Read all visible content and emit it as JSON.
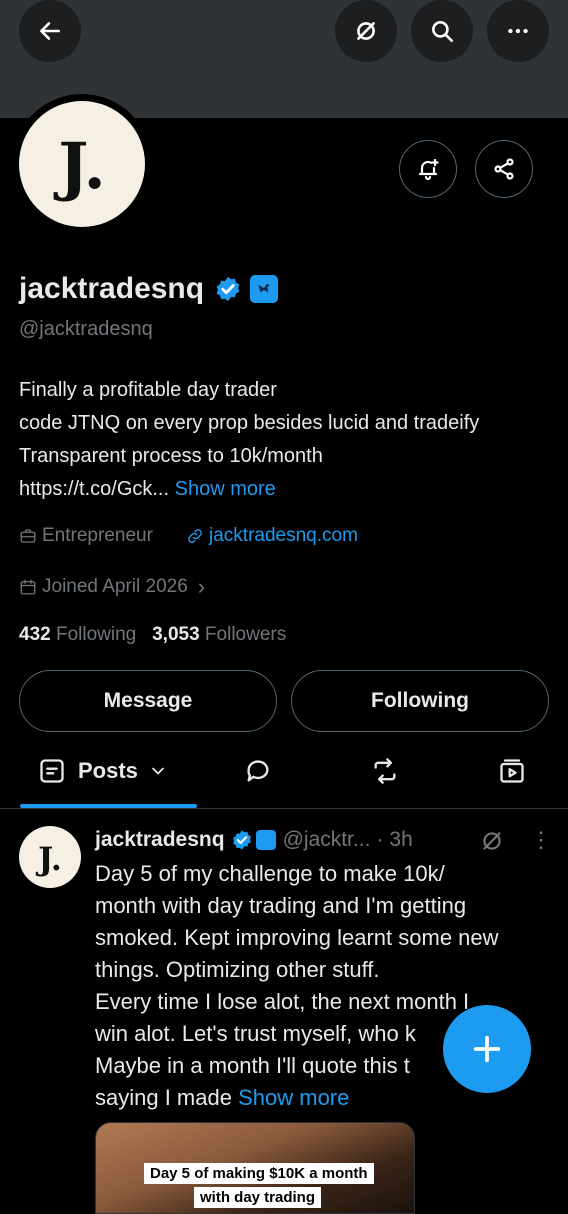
{
  "profile": {
    "display_name": "jacktradesnq",
    "handle": "@jacktradesnq",
    "avatar_letter": "J.",
    "bio_lines": [
      "Finally a profitable day trader",
      "code JTNQ on every prop besides lucid and tradeify",
      "Transparent process to 10k/month"
    ],
    "bio_link_text": "https://t.co/Gck...",
    "bio_show_more": "Show more",
    "category": "Entrepreneur",
    "website": "jacktradesnq.com",
    "joined": "Joined April 2026",
    "joined_chevron": "›",
    "following_count": "432",
    "following_label": "Following",
    "followers_count": "3,053",
    "followers_label": "Followers"
  },
  "actions": {
    "message": "Message",
    "following": "Following"
  },
  "tabs": {
    "posts": "Posts"
  },
  "post": {
    "author": "jacktradesnq",
    "handle": "@jacktr...",
    "separator": "·",
    "time": "3h",
    "more": "⋮",
    "lines": [
      "Day 5 of my challenge to make 10k/",
      "month with day trading and I'm getting",
      "smoked. Kept improving learnt some new",
      "things. Optimizing other stuff.",
      "Every time I lose alot, the next month I",
      "win alot. Let's trust myself, who k",
      "Maybe in a month I'll quote this t"
    ],
    "last_line": "saying I made",
    "show_more": "Show more",
    "media_caption_1": "Day 5  of making $10K a month",
    "media_caption_2": "with day trading"
  },
  "colors": {
    "accent": "#1d9bf0",
    "muted": "#71767b",
    "avatar_bg": "#f6f0e4",
    "avatar_dot": "#d3a338"
  }
}
